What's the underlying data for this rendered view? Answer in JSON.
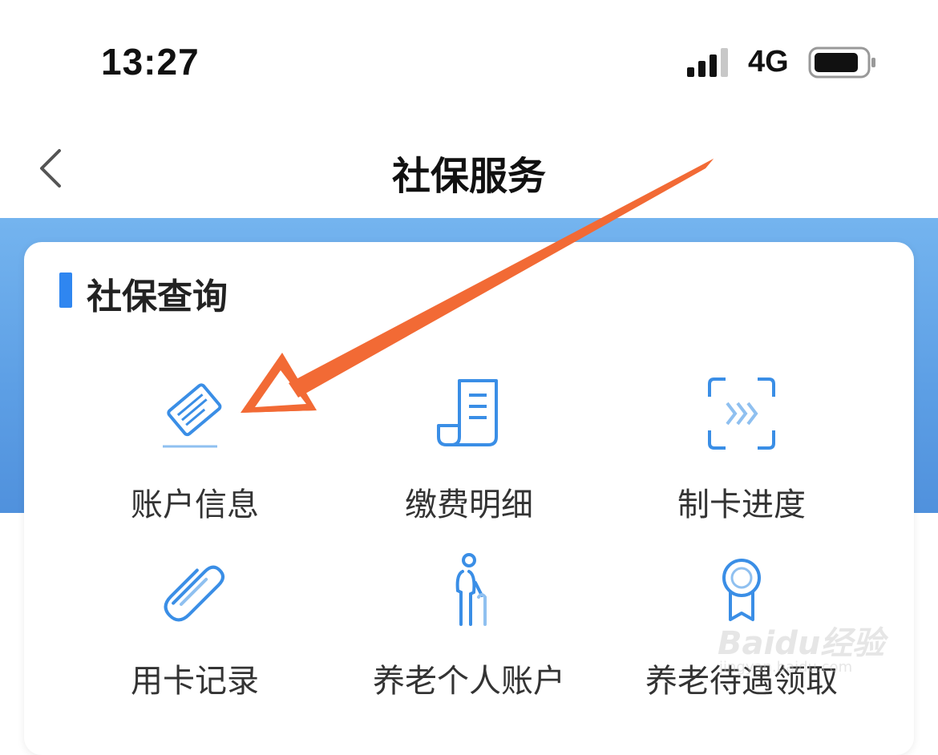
{
  "status_bar": {
    "time": "13:27",
    "network": "4G"
  },
  "nav": {
    "title": "社保服务"
  },
  "section": {
    "title": "社保查询"
  },
  "items": [
    {
      "label": "账户信息",
      "icon": "card-icon"
    },
    {
      "label": "缴费明细",
      "icon": "receipt-icon"
    },
    {
      "label": "制卡进度",
      "icon": "scan-progress-icon"
    },
    {
      "label": "用卡记录",
      "icon": "paperclip-icon"
    },
    {
      "label": "养老个人账户",
      "icon": "elderly-person-icon"
    },
    {
      "label": "养老待遇领取",
      "icon": "medal-icon"
    }
  ],
  "watermark": {
    "text": "Baidu经验",
    "sub": "jingyan.baidu.com"
  },
  "colors": {
    "accent": "#2f86f0",
    "icon": "#3a8ee6",
    "arrow": "#f26a35"
  }
}
